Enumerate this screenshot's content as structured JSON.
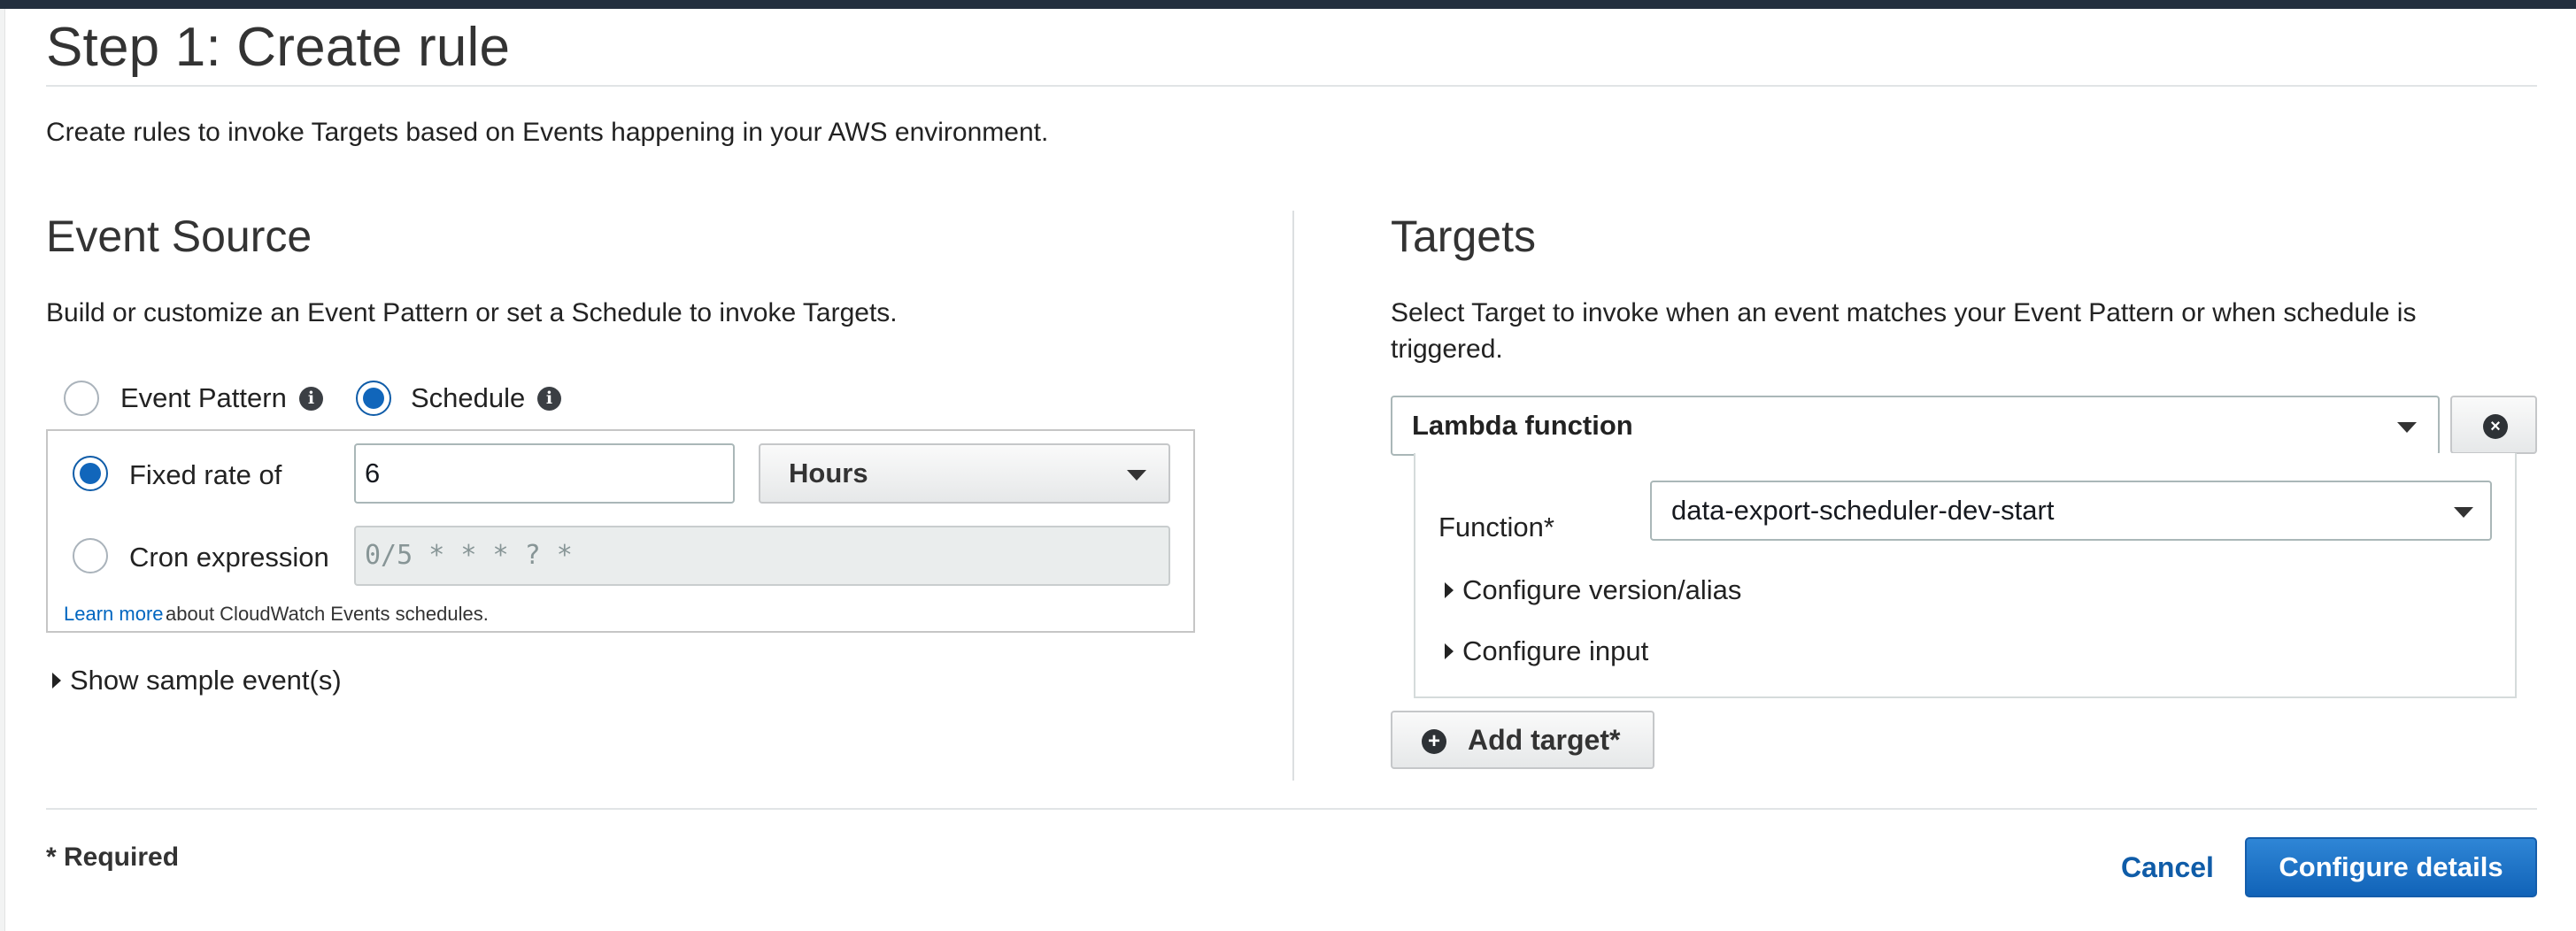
{
  "page": {
    "title": "Step 1: Create rule",
    "description": "Create rules to invoke Targets based on Events happening in your AWS environment."
  },
  "event_source": {
    "heading": "Event Source",
    "description": "Build or customize an Event Pattern or set a Schedule to invoke Targets.",
    "source_options": [
      {
        "label": "Event Pattern",
        "selected": false
      },
      {
        "label": "Schedule",
        "selected": true
      }
    ],
    "schedule": {
      "fixed_rate_label": "Fixed rate of",
      "fixed_rate_selected": true,
      "fixed_rate_value": "6",
      "unit": "Hours",
      "cron_label": "Cron expression",
      "cron_selected": false,
      "cron_placeholder": "0/5 * * * ? *",
      "learn_more": "Learn more",
      "learn_more_rest": "about CloudWatch Events schedules."
    },
    "show_sample": "Show sample event(s)"
  },
  "targets": {
    "heading": "Targets",
    "description_line1": "Select Target to invoke when an event matches your Event Pattern or when schedule is",
    "description_line2": "triggered.",
    "target_type": "Lambda function",
    "function_label": "Function*",
    "function_value": "data-export-scheduler-dev-start",
    "configure_version": "Configure version/alias",
    "configure_input": "Configure input",
    "add_target": "Add target*"
  },
  "footer": {
    "required_note": "* Required",
    "cancel": "Cancel",
    "configure_details": "Configure details"
  },
  "colors": {
    "primary": "#1166bb",
    "link": "#0066c0",
    "topbar": "#232f3e"
  },
  "icons": [
    "info-icon",
    "remove-circle-icon",
    "add-circle-icon",
    "caret-down-icon",
    "caret-right-icon"
  ]
}
